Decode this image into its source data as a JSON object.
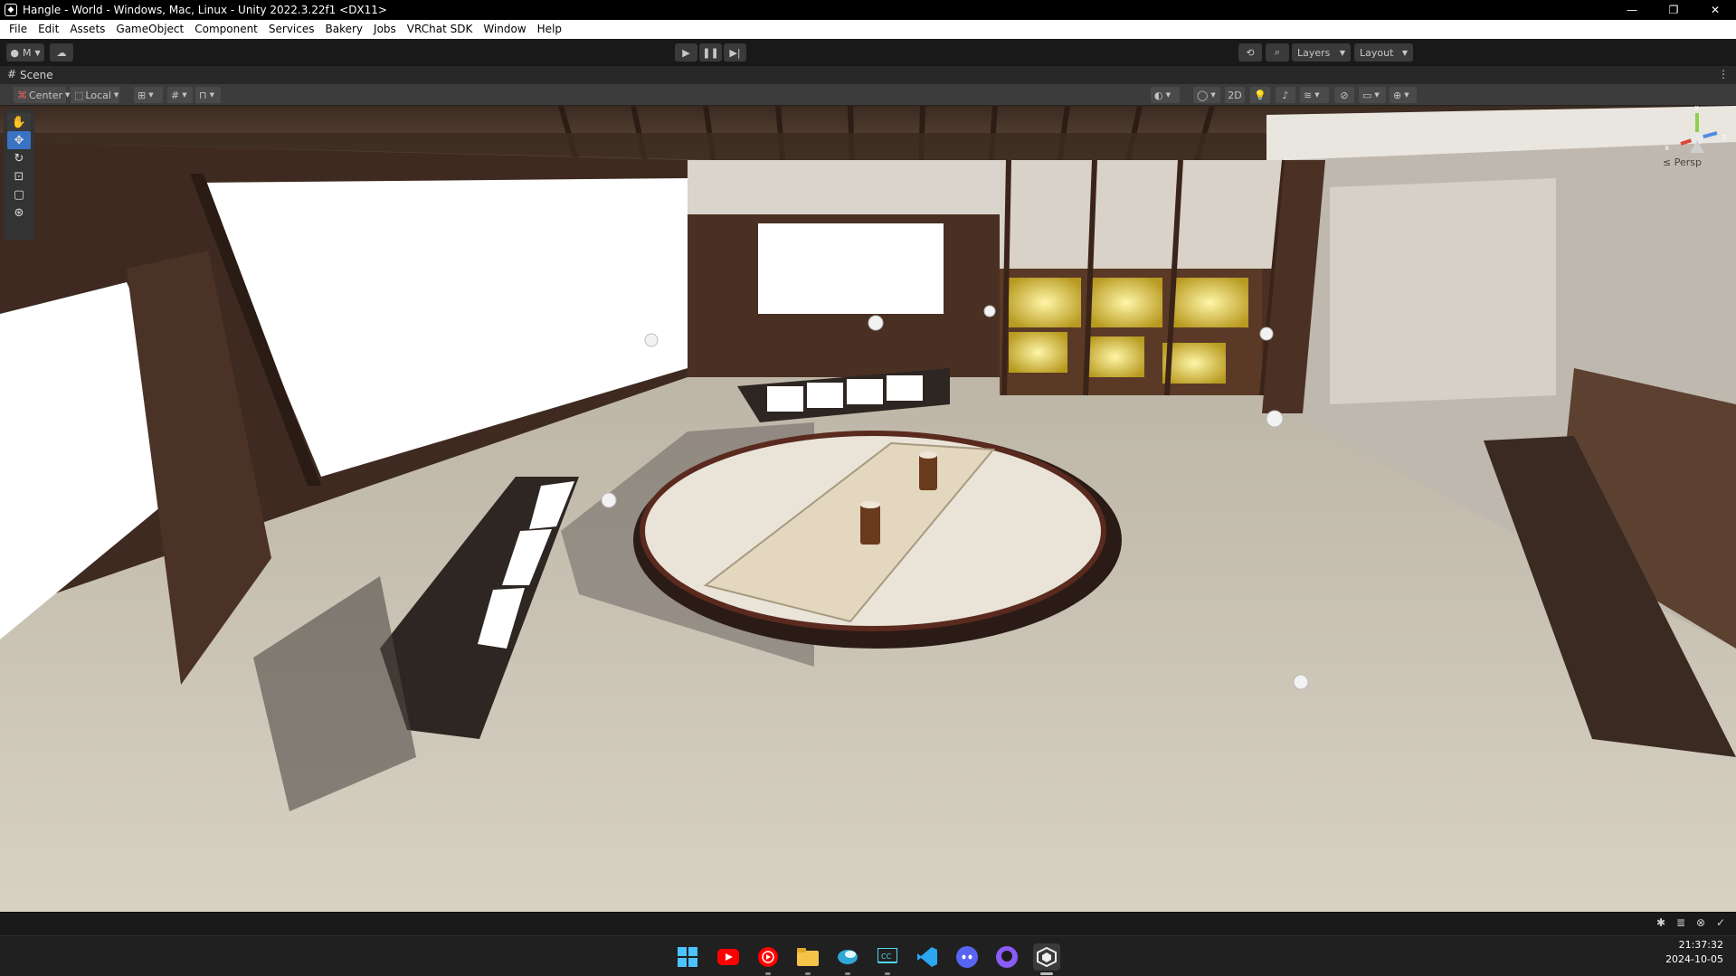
{
  "window": {
    "title": "Hangle - World - Windows, Mac, Linux - Unity 2022.3.22f1 <DX11>"
  },
  "menu": [
    "File",
    "Edit",
    "Assets",
    "GameObject",
    "Component",
    "Services",
    "Bakery",
    "Jobs",
    "VRChat SDK",
    "Window",
    "Help"
  ],
  "toolbar": {
    "account_label": "M",
    "layers_label": "Layers",
    "layout_label": "Layout"
  },
  "scene": {
    "tab_label": "Scene",
    "pivot_label": "Center",
    "space_label": "Local",
    "mode_2d_label": "2D",
    "projection_label": "Persp"
  },
  "gizmo_axes": {
    "y": "y",
    "z": "z",
    "x": "x"
  },
  "taskbar": {
    "apps": [
      "start-button",
      "youtube-app",
      "youtube-music-app",
      "file-explorer-app",
      "bluesky-app",
      "captions-app",
      "vscode-app",
      "discord-app",
      "github-app",
      "unity-app"
    ],
    "time": "21:37:32",
    "date": "2024-10-05"
  },
  "colors": {
    "accent": "#3a72c4",
    "unity_bg": "#191919",
    "panel": "#3c3c3c"
  }
}
